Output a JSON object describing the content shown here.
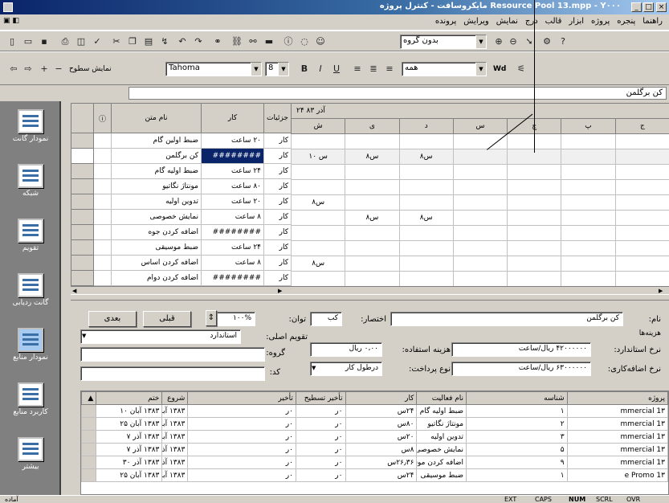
{
  "window": {
    "title": "Resource Pool 13.mpp - Y۰۰۰ مایکروسافت - کنترل پروژه"
  },
  "menu": {
    "items": [
      "پرونده",
      "ویرایش",
      "نمایش",
      "درج",
      "قالب",
      "ابزار",
      "پروژه",
      "پنجره",
      "راهنما"
    ]
  },
  "toolbar1": {
    "group_combo": "بدون گروه"
  },
  "toolbar2": {
    "outline_label": "نمایش سطوح",
    "font": "Tahoma",
    "size": "8",
    "filter": "همه",
    "width_label": "Wd"
  },
  "entry": {
    "value": "کن برگلمن"
  },
  "viewbar": {
    "items": [
      "نمودار گانت",
      "شبکه",
      "تقویم",
      "گانت ردیابی",
      "نمودار منابع",
      "کاربرد منابع",
      "بیشتر"
    ]
  },
  "sheet": {
    "headers": {
      "info": "ⓘ",
      "task": "نام متن",
      "work": "کار",
      "details": "جزئیات"
    },
    "rows": [
      {
        "task": "ضبط اولین گام",
        "work": "۲۰ ساعت",
        "detail": "کار"
      },
      {
        "task": "کن برگلمن",
        "work": "########",
        "detail": "کار",
        "selected": true
      },
      {
        "task": "ضبط اولیه گام",
        "work": "۲۴ ساعت",
        "detail": "کار"
      },
      {
        "task": "مونتاژ نگاتیو",
        "work": "۸۰ ساعت",
        "detail": "کار"
      },
      {
        "task": "تدوین اولیه",
        "work": "۲۰ ساعت",
        "detail": "کار"
      },
      {
        "task": "نمایش خصوصی",
        "work": "۸ ساعت",
        "detail": "کار"
      },
      {
        "task": "اضافه کردن جوه",
        "work": "########",
        "detail": "کار"
      },
      {
        "task": "ضبط موسیقی",
        "work": "۲۴ ساعت",
        "detail": "کار"
      },
      {
        "task": "اضافه کردن اساس",
        "work": "۸ ساعت",
        "detail": "کار"
      },
      {
        "task": "اضافه کردن دوام",
        "work": "########",
        "detail": "کار"
      }
    ]
  },
  "timescale": {
    "week_label": "۲۴ آذر ۸۳",
    "days": [
      "ش",
      "ی",
      "د",
      "س",
      "چ",
      "پ",
      "ج"
    ],
    "cells": [
      [
        "",
        "",
        "",
        "",
        "",
        "",
        ""
      ],
      [
        "۱۰ س",
        "۸س",
        "۸س",
        "",
        "",
        "",
        ""
      ],
      [
        "",
        "",
        "",
        "",
        "",
        "",
        ""
      ],
      [
        "",
        "",
        "",
        "",
        "",
        "",
        ""
      ],
      [
        "۸س",
        "",
        "",
        "",
        "",
        "",
        ""
      ],
      [
        "",
        "۸س",
        "۸س",
        "",
        "",
        "",
        ""
      ],
      [
        "",
        "",
        "",
        "",
        "",
        "",
        ""
      ],
      [
        "",
        "",
        "",
        "",
        "",
        "",
        ""
      ],
      [
        "۸س",
        "",
        "",
        "",
        "",
        "",
        ""
      ],
      [
        "",
        "",
        "",
        "",
        "",
        "",
        ""
      ]
    ]
  },
  "form": {
    "name_label": "نام:",
    "name_value": "کن برگلمن",
    "initials_label": "اختصار:",
    "initials_value": "کب",
    "max_units_label": "توان:",
    "max_units_value": "۱۰۰%",
    "prev_button": "قبلی",
    "next_button": "بعدی",
    "costs_label": "هزینه‌ها",
    "std_rate_label": "نرخ استاندارد:",
    "std_rate_value": "۴۲۰۰۰۰۰۰ ریال/ساعت",
    "per_use_label": "هزینه استفاده:",
    "per_use_value": "۰،۰۰ ریال",
    "ovt_rate_label": "نرخ اضافه‌کاری:",
    "ovt_rate_value": "۶۳۰۰۰۰۰۰ ریال/ساعت",
    "accrue_label": "نوع پرداخت:",
    "accrue_value": "درطول کار",
    "base_cal_label": "تقویم اصلی:",
    "base_cal_value": "استاندارد",
    "group_label": "گروه:",
    "code_label": "کد:"
  },
  "detail": {
    "headers": [
      "پروژه",
      "شناسه",
      "نام فعالیت",
      "کار",
      "تأخیر تسطیح",
      "تأخیر",
      "شروع",
      "ختم"
    ],
    "rows": [
      [
        "mmercial 1۳",
        "۱",
        "ضبط اولیه گام",
        "۲۴س",
        "۰ر",
        "۰ر",
        "۱۳۸۳ آبان ۵",
        "۱۳۸۳ آبان ۱۰"
      ],
      [
        "mmercial 1۳",
        "۲",
        "مونتاژ نگاتیو",
        "۸۰س",
        "۰ر",
        "۰ر",
        "۱۳۸۳ آبان ۱۱",
        "۱۳۸۳ آبان ۲۵"
      ],
      [
        "mmercial 1۳",
        "۳",
        "تدوین اولیه",
        "۲۰س",
        "۰ر",
        "۰ر",
        "۱۳۸۳ آبان ۲۵",
        "۱۳۸۳ آذر ۷"
      ],
      [
        "mmercial 1۳",
        "۵",
        "نمایش خصوصی فیلم",
        "۸س",
        "۰ر",
        "۰ر",
        "۱۳۸۳ آذر ۷",
        "۱۳۸۳ آذر ۷"
      ],
      [
        "mmercial 1۳",
        "۹",
        "اضافه کردن موسیقی",
        "۲۶٫۳۶س",
        "۰ر",
        "۰ر",
        "۱۳۸۳ آذر ۲۵",
        "۱۳۸۳ آذر ۳۰"
      ],
      [
        "e Promo 1۳",
        "۱",
        "ضبط موسیقی",
        "۲۴س",
        "۰ر",
        "۰ر",
        "۱۳۸۳ آبان ۱۵",
        "۱۳۸۳ آبان ۲۵"
      ]
    ]
  },
  "status": {
    "ready": "آماده",
    "ext": "EXT",
    "caps": "CAPS",
    "num": "NUM",
    "scrl": "SCRL",
    "ovr": "OVR"
  }
}
